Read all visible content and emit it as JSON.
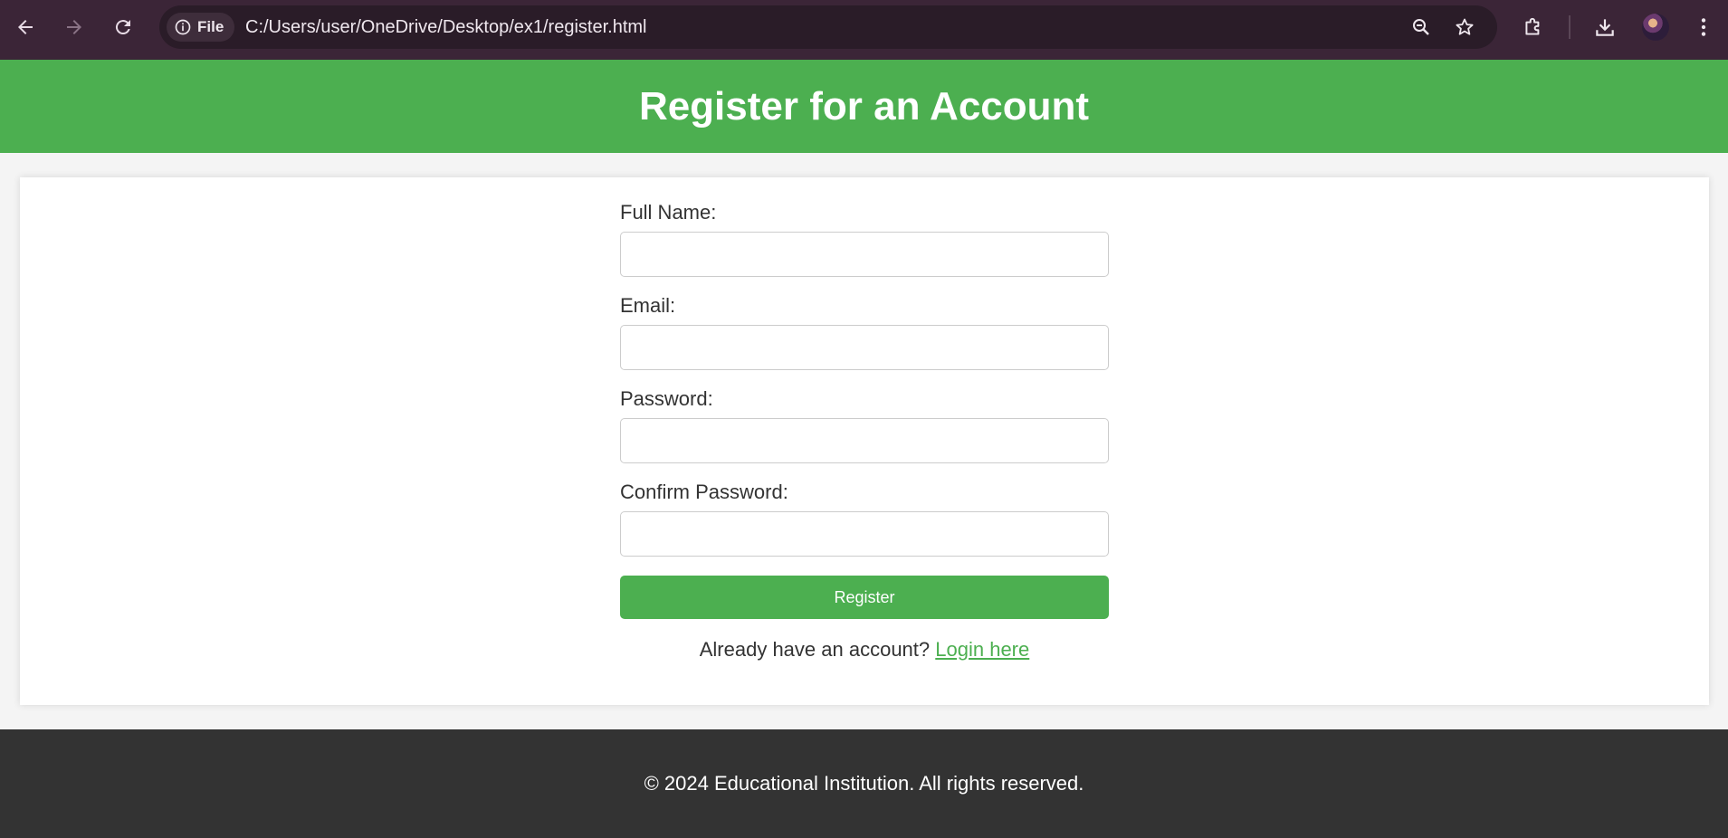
{
  "browser": {
    "site_chip_label": "File",
    "url": "C:/Users/user/OneDrive/Desktop/ex1/register.html",
    "icons": [
      "back-arrow-icon",
      "forward-arrow-icon",
      "reload-icon",
      "info-icon",
      "zoom-icon",
      "star-icon",
      "extensions-icon",
      "download-icon",
      "profile-avatar",
      "more-vert-icon"
    ]
  },
  "header": {
    "title": "Register for an Account"
  },
  "form": {
    "fields": [
      {
        "label": "Full Name:",
        "value": ""
      },
      {
        "label": "Email:",
        "value": ""
      },
      {
        "label": "Password:",
        "value": ""
      },
      {
        "label": "Confirm Password:",
        "value": ""
      }
    ],
    "submit_label": "Register",
    "login_prompt": "Already have an account?",
    "login_link": "Login here"
  },
  "footer": {
    "text": "© 2024 Educational Institution. All rights reserved."
  },
  "colors": {
    "browser_frame": "#3b2537",
    "accent_green": "#4caf50",
    "footer_bg": "#333333",
    "page_bg": "#f4f4f4"
  }
}
